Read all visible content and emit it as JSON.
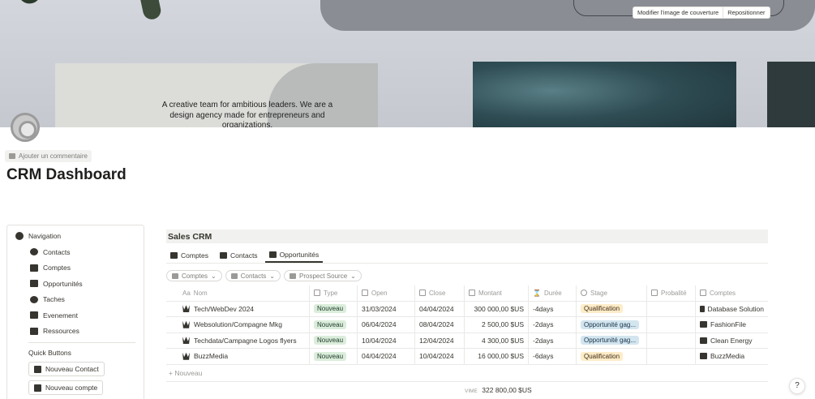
{
  "cover": {
    "tagline": "A creative team for ambitious leaders. We are a design agency made for entrepreneurs and organizations.",
    "change_cover_label": "Modifier l'image de couverture",
    "reposition_label": "Repositionner"
  },
  "comment": {
    "label": "Ajouter un commentaire"
  },
  "page": {
    "title": "CRM Dashboard"
  },
  "navigation": {
    "title": "Navigation",
    "items": [
      {
        "label": "Contacts",
        "icon": "person-icon"
      },
      {
        "label": "Comptes",
        "icon": "buildings-icon"
      },
      {
        "label": "Opportunités",
        "icon": "crown-icon"
      },
      {
        "label": "Taches",
        "icon": "check-circle-icon"
      },
      {
        "label": "Evenement",
        "icon": "calendar-icon"
      },
      {
        "label": "Ressources",
        "icon": "layers-icon"
      }
    ],
    "quick_buttons_title": "Quick Buttons",
    "quick_buttons": [
      {
        "label": "Nouveau Contact"
      },
      {
        "label": "Nouveau compte"
      }
    ]
  },
  "database": {
    "title": "Sales CRM",
    "views": [
      {
        "label": "Comptes"
      },
      {
        "label": "Contacts"
      },
      {
        "label": "Opportunités"
      }
    ],
    "filters": [
      {
        "label": "Comptes"
      },
      {
        "label": "Contacts"
      },
      {
        "label": "Prospect Source"
      }
    ],
    "columns": {
      "nom": "Nom",
      "type": "Type",
      "open": "Open",
      "close": "Close",
      "montant": "Montant",
      "duree": "Durée",
      "stage": "Stage",
      "proba": "Probalité",
      "comptes": "Comptes"
    },
    "rows": [
      {
        "nom": "Tech/WebDev 2024",
        "type": "Nouveau",
        "open": "31/03/2024",
        "close": "04/04/2024",
        "montant": "300 000,00 $US",
        "duree": "-4days",
        "stage": "Qualification",
        "stage_color": "orange",
        "proba": "",
        "comptes": "Database Solution"
      },
      {
        "nom": "Websolution/Compagne Mkg",
        "type": "Nouveau",
        "open": "06/04/2024",
        "close": "08/04/2024",
        "montant": "2 500,00 $US",
        "duree": "-2days",
        "stage": "Opportunité gag...",
        "stage_color": "blue",
        "proba": "",
        "comptes": "FashionFile"
      },
      {
        "nom": "Techdata/Campagne Logos flyers",
        "type": "Nouveau",
        "open": "10/04/2024",
        "close": "12/04/2024",
        "montant": "4 300,00 $US",
        "duree": "-2days",
        "stage": "Opportunité gag...",
        "stage_color": "blue",
        "proba": "",
        "comptes": "Clean Energy"
      },
      {
        "nom": "BuzzMedia",
        "type": "Nouveau",
        "open": "04/04/2024",
        "close": "10/04/2024",
        "montant": "16 000,00 $US",
        "duree": "-6days",
        "stage": "Qualification",
        "stage_color": "orange",
        "proba": "",
        "comptes": "BuzzMedia"
      }
    ],
    "new_label": "+ Nouveau",
    "sum_label": "VIME",
    "sum_value": "322 800,00 $US"
  },
  "help": {
    "label": "?"
  }
}
